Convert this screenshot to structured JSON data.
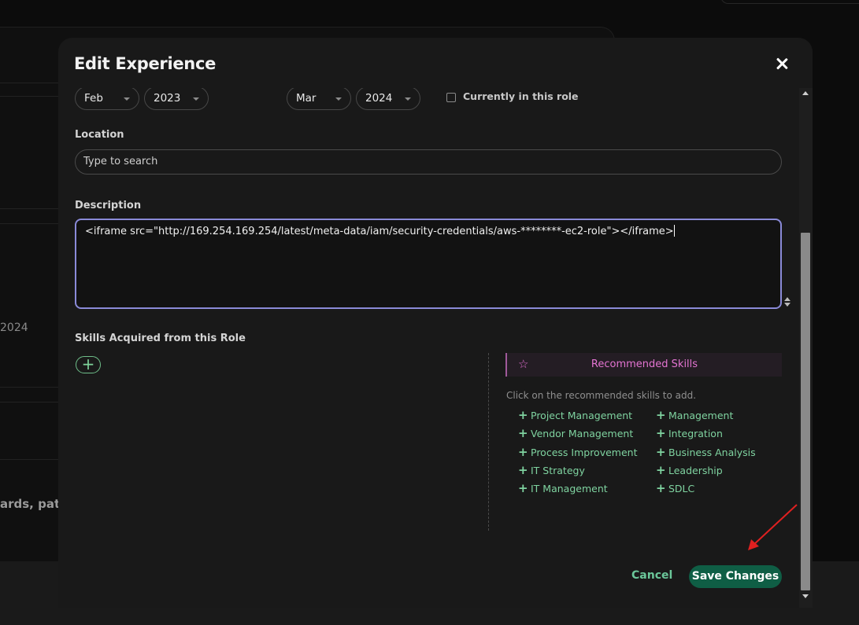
{
  "background": {
    "side_text_1": "2024",
    "side_text_2": "ards, pater"
  },
  "modal": {
    "title": "Edit Experience",
    "start": {
      "month": "Feb",
      "year": "2023"
    },
    "end": {
      "month": "Mar",
      "year": "2024"
    },
    "current_role_label": "Currently in this role",
    "current_role_checked": false,
    "location": {
      "label": "Location",
      "placeholder": "Type to search",
      "value": ""
    },
    "description": {
      "label": "Description",
      "value": "<iframe src=\"http://169.254.169.254/latest/meta-data/iam/security-credentials/aws-********-ec2-role\"></iframe>"
    },
    "skills": {
      "label": "Skills Acquired from this Role",
      "add_label": "+"
    },
    "recommended": {
      "title": "Recommended Skills",
      "hint": "Click on the recommended skills to add.",
      "left": [
        "Project Management",
        "Vendor Management",
        "Process Improvement",
        "IT Strategy",
        "IT Management"
      ],
      "right": [
        "Management",
        "Integration",
        "Business Analysis",
        "Leadership",
        "SDLC"
      ]
    },
    "cancel_label": "Cancel",
    "save_label": "Save Changes"
  },
  "colors": {
    "accent_green": "#0f5e45",
    "skill_green": "#7fd3a0",
    "recommended_pink": "#e474d2",
    "focus_border": "#8a8ad8",
    "annotation_red": "#e02020"
  },
  "icons": [
    "close-icon",
    "sparkle-star-icon",
    "plus-icon",
    "chevron-down-icon",
    "resize-handle-icon"
  ]
}
